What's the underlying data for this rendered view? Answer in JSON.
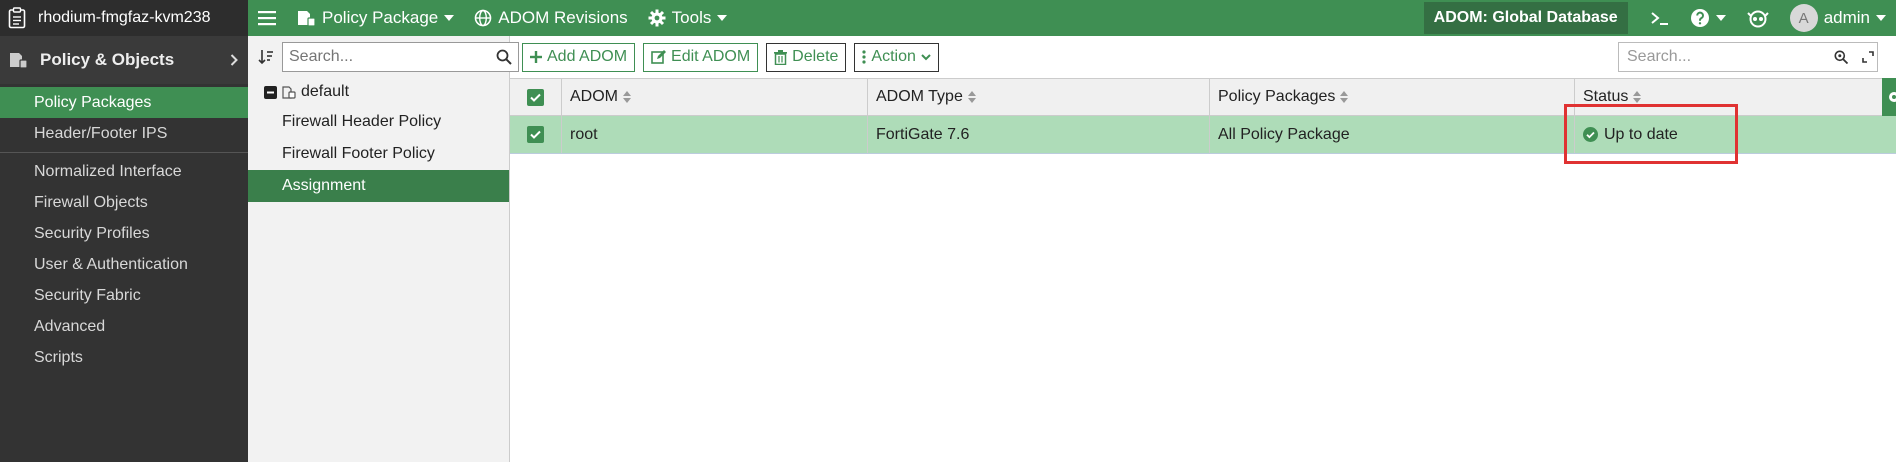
{
  "device": {
    "name": "rhodium-fmgfaz-kvm238"
  },
  "topnav": {
    "policy_package": "Policy Package",
    "adom_revisions": "ADOM Revisions",
    "tools": "Tools",
    "adom_badge": "ADOM: Global Database",
    "user": "admin",
    "avatar_letter": "A"
  },
  "sidebar": {
    "section": "Policy & Objects",
    "items": [
      {
        "label": "Policy Packages"
      },
      {
        "label": "Header/Footer IPS"
      },
      {
        "label": "Normalized Interface"
      },
      {
        "label": "Firewall Objects"
      },
      {
        "label": "Security Profiles"
      },
      {
        "label": "User & Authentication"
      },
      {
        "label": "Security Fabric"
      },
      {
        "label": "Advanced"
      },
      {
        "label": "Scripts"
      }
    ]
  },
  "tree": {
    "search_placeholder": "Search...",
    "root": "default",
    "items": [
      {
        "label": "Firewall Header Policy"
      },
      {
        "label": "Firewall Footer Policy"
      },
      {
        "label": "Assignment"
      }
    ]
  },
  "toolbar": {
    "add": "Add ADOM",
    "edit": "Edit ADOM",
    "delete": "Delete",
    "action": "Action",
    "search_placeholder": "Search..."
  },
  "table": {
    "headers": [
      "ADOM",
      "ADOM Type",
      "Policy Packages",
      "Status"
    ],
    "rows": [
      {
        "adom": "root",
        "type": "FortiGate 7.6",
        "packages": "All Policy Package",
        "status": "Up to date"
      }
    ]
  },
  "colors": {
    "accent": "#3f8f53",
    "selected_row": "#aedcb8",
    "highlight": "#e03232"
  }
}
